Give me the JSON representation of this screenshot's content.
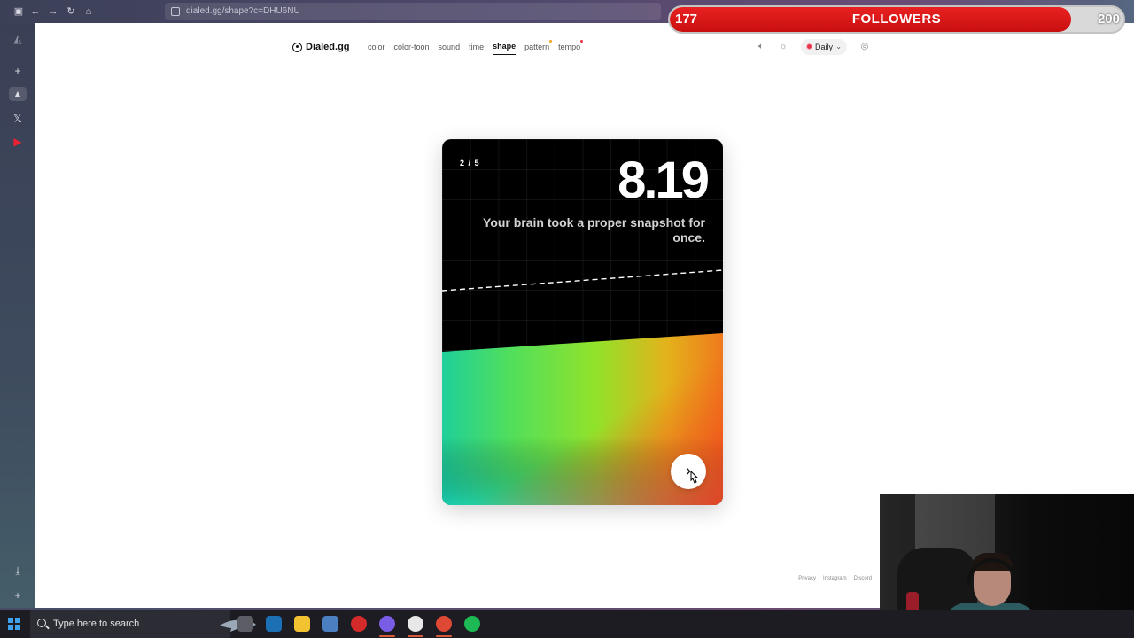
{
  "browser": {
    "url": "dialed.gg/shape?c=DHU6NU"
  },
  "site": {
    "logo_text": "Dialed.gg",
    "nav": [
      {
        "label": "color",
        "active": false,
        "dot": ""
      },
      {
        "label": "color-toon",
        "active": false,
        "dot": ""
      },
      {
        "label": "sound",
        "active": false,
        "dot": ""
      },
      {
        "label": "time",
        "active": false,
        "dot": ""
      },
      {
        "label": "shape",
        "active": true,
        "dot": ""
      },
      {
        "label": "pattern",
        "active": false,
        "dot": "#f5a623"
      },
      {
        "label": "tempo",
        "active": false,
        "dot": "#e8344a"
      }
    ],
    "mode_select": "Daily",
    "icons": [
      "speaker-icon",
      "sun-icon",
      "user-icon"
    ]
  },
  "card": {
    "progress": "2 / 5",
    "score": "8.19",
    "message": "Your brain took a proper snapshot for once.",
    "next_icon": "chevron-right-icon"
  },
  "footer": {
    "links": [
      "Privacy",
      "Instagram",
      "Discord"
    ]
  },
  "overlay": {
    "followers_current": "177",
    "followers_label": "FOLLOWERS",
    "followers_goal": "200",
    "progress_fraction": 0.885
  },
  "taskbar": {
    "search_placeholder": "Type here to search",
    "apps": [
      "file-explorer-icon",
      "steam-icon",
      "folder-icon",
      "calculator-icon",
      "opera-icon",
      "discord-icon",
      "obs-icon",
      "chrome-icon",
      "spotify-icon"
    ]
  }
}
